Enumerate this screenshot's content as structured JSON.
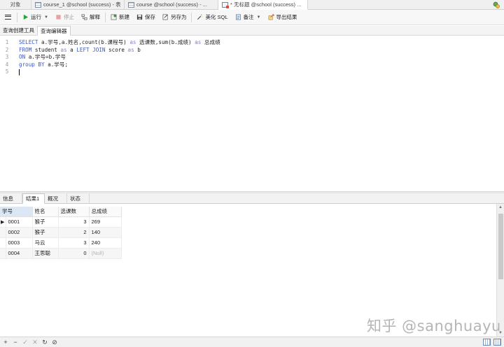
{
  "tabs": {
    "objects": "对象",
    "items": [
      {
        "label": "course_1 @school (success) - 表"
      },
      {
        "label": "course @school (success) - ..."
      },
      {
        "label": "* 无标题 @school (success) ..."
      }
    ]
  },
  "toolbar": {
    "run": "运行",
    "stop": "停止",
    "explain": "解释",
    "new": "新建",
    "save": "保存",
    "save_as": "另存为",
    "beautify": "美化 SQL",
    "comment": "备注",
    "export": "导出结果"
  },
  "subtabs": {
    "builder": "查询创建工具",
    "editor": "查询编辑器"
  },
  "editor": {
    "line_numbers": [
      "1",
      "2",
      "3",
      "4",
      "5"
    ],
    "lines": [
      [
        {
          "t": "SELECT",
          "c": "kw"
        },
        {
          "t": " a.学号,a.姓名,count(b.课程号) ",
          "c": ""
        },
        {
          "t": "as",
          "c": "as"
        },
        {
          "t": " 选课数,sum(b.成绩) ",
          "c": ""
        },
        {
          "t": "as",
          "c": "as"
        },
        {
          "t": " 总成绩",
          "c": ""
        }
      ],
      [
        {
          "t": "FROM",
          "c": "kw"
        },
        {
          "t": " student ",
          "c": ""
        },
        {
          "t": "as",
          "c": "as"
        },
        {
          "t": " a ",
          "c": ""
        },
        {
          "t": "LEFT JOIN",
          "c": "kw"
        },
        {
          "t": " score ",
          "c": ""
        },
        {
          "t": "as",
          "c": "as"
        },
        {
          "t": " b",
          "c": ""
        }
      ],
      [
        {
          "t": "ON",
          "c": "kw"
        },
        {
          "t": " a.学号=b.学号",
          "c": ""
        }
      ],
      [
        {
          "t": "group BY",
          "c": "kw"
        },
        {
          "t": " a.学号;",
          "c": ""
        }
      ],
      []
    ]
  },
  "result_tabs": [
    "信息",
    "结果1",
    "概况",
    "状态"
  ],
  "results": {
    "columns": [
      "学号",
      "姓名",
      "选课数",
      "总成绩"
    ],
    "rows": [
      {
        "id": "0001",
        "name": "猴子",
        "count": "3",
        "total": "269"
      },
      {
        "id": "0002",
        "name": "猴子",
        "count": "2",
        "total": "140"
      },
      {
        "id": "0003",
        "name": "马云",
        "count": "3",
        "total": "240"
      },
      {
        "id": "0004",
        "name": "王思聪",
        "count": "0",
        "total": "(Null)"
      }
    ]
  },
  "watermark": "知乎 @sanghuayu",
  "colors": {
    "keyword": "#3b57c8",
    "as_keyword": "#8b7fbf",
    "run_green": "#27a337",
    "stop_red": "#d9534f"
  }
}
